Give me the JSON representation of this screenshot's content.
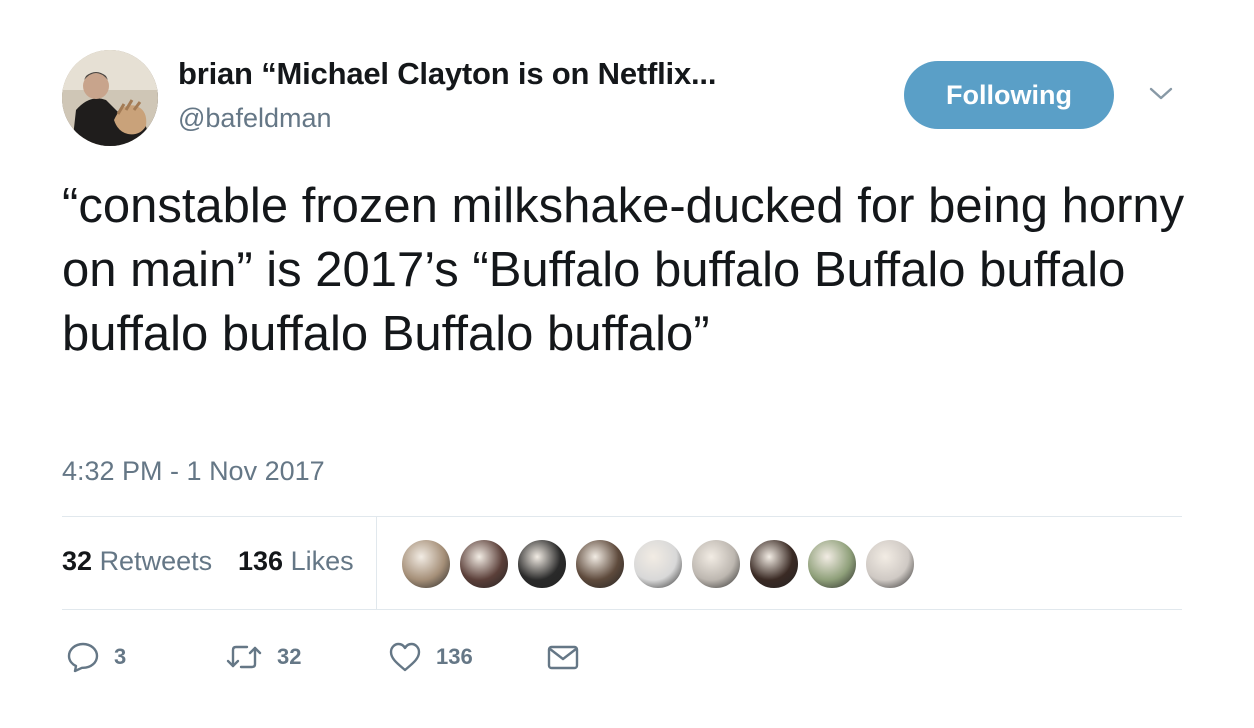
{
  "author": {
    "display_name": "brian “Michael Clayton is on Netflix...",
    "handle": "@bafeldman"
  },
  "follow_button": {
    "label": "Following",
    "color": "#5a9fc7"
  },
  "menu_icon": "chevron-down-icon",
  "tweet": {
    "text": "“constable frozen milkshake-ducked for being horny on main” is 2017’s “Buffalo buffalo Buffalo buffalo buffalo buffalo Buffalo buffalo”",
    "timestamp": "4:32 PM - 1 Nov 2017"
  },
  "stats": {
    "retweets_count": "32",
    "retweets_label": "Retweets",
    "likes_count": "136",
    "likes_label": "Likes"
  },
  "likers": [
    {
      "color": "#a58f78"
    },
    {
      "color": "#5b3f39"
    },
    {
      "color": "#2a2a2a"
    },
    {
      "color": "#5e4a3c"
    },
    {
      "color": "#d8d8d8"
    },
    {
      "color": "#bdb7b0"
    },
    {
      "color": "#3a2a24"
    },
    {
      "color": "#8fa07a"
    },
    {
      "color": "#cfc9c4"
    }
  ],
  "actions": {
    "reply": {
      "icon": "reply-icon",
      "count": "3"
    },
    "retweet": {
      "icon": "retweet-icon",
      "count": "32"
    },
    "like": {
      "icon": "heart-icon",
      "count": "136"
    },
    "dm": {
      "icon": "envelope-icon"
    }
  },
  "colors": {
    "text": "#14171a",
    "secondary": "#657786",
    "divider": "#e1e8ed"
  }
}
